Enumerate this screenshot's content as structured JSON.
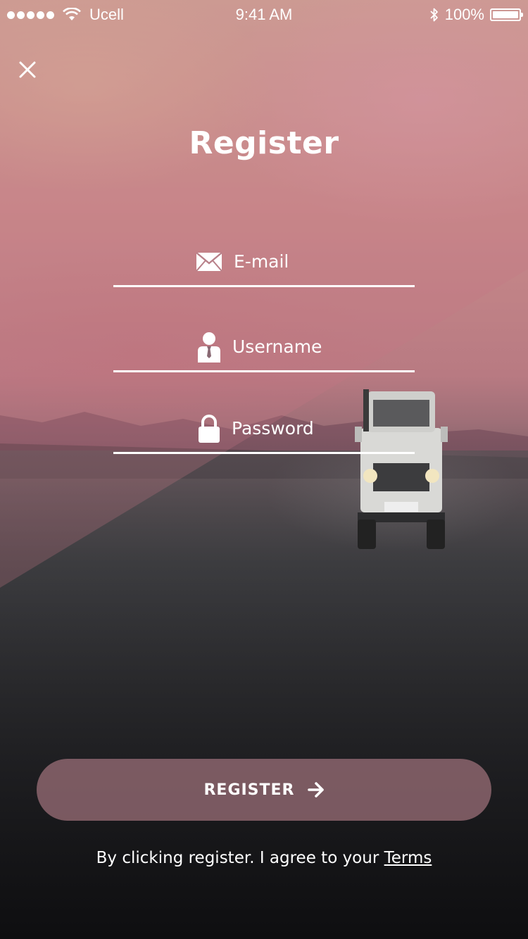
{
  "status_bar": {
    "carrier": "Ucell",
    "time": "9:41 AM",
    "battery": "100%"
  },
  "icons": {
    "close": "close-icon",
    "email": "envelope-icon",
    "username": "user-icon",
    "password": "lock-icon",
    "arrow": "arrow-right-icon"
  },
  "page": {
    "title": "Register"
  },
  "form": {
    "email_placeholder": "E-mail",
    "username_placeholder": "Username",
    "password_placeholder": "Password"
  },
  "register_button": {
    "label": "REGISTER"
  },
  "terms": {
    "text": "By clicking register. I agree to your ",
    "link": "Terms"
  },
  "colors": {
    "button_bg": "#906870",
    "text": "#ffffff"
  }
}
